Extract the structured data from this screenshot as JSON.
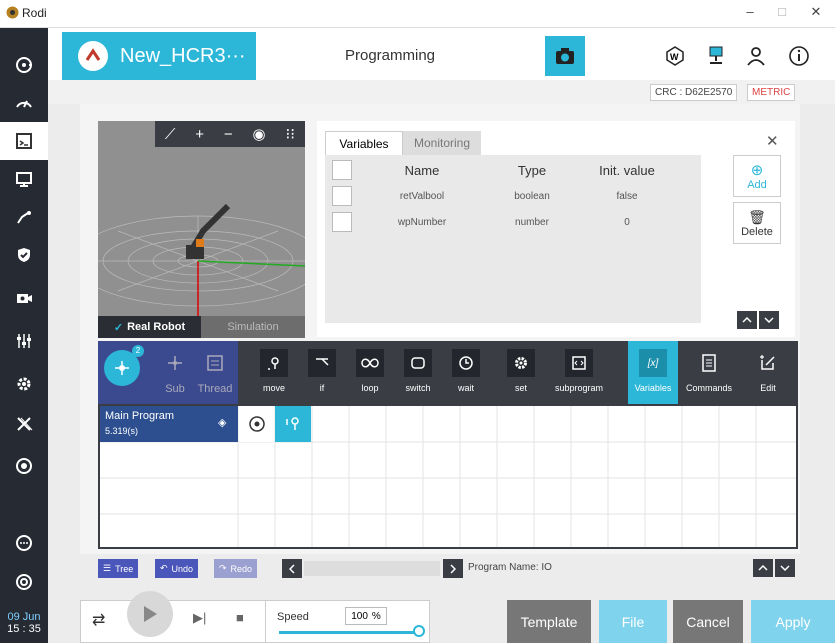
{
  "window": {
    "title": "Rodi"
  },
  "header": {
    "project_name": "New_HCR3···",
    "page_title": "Programming"
  },
  "status": {
    "crc": "CRC : D62E2570",
    "unit": "METRIC"
  },
  "viewport": {
    "tabs": [
      "Real Robot",
      "Simulation"
    ],
    "active_tab": "Real Robot"
  },
  "variables_panel": {
    "tabs": [
      "Variables",
      "Monitoring"
    ],
    "columns": [
      "Name",
      "Type",
      "Init. value"
    ],
    "rows": [
      {
        "name": "retValbool",
        "type": "boolean",
        "init": "false"
      },
      {
        "name": "wpNumber",
        "type": "number",
        "init": "0"
      }
    ],
    "add_label": "Add",
    "delete_label": "Delete"
  },
  "command_bar": {
    "left": [
      {
        "label": "Sub"
      },
      {
        "label": "Thread"
      }
    ],
    "badge": "2",
    "commands": [
      "move",
      "if",
      "loop",
      "switch",
      "wait",
      "set",
      "subprogram"
    ],
    "right": [
      "Variables",
      "Commands",
      "Edit"
    ]
  },
  "program": {
    "main_label": "Main Program",
    "time": "5.319(s)",
    "name_label": "Program Name: IO"
  },
  "nav": {
    "tree": "Tree",
    "undo": "Undo",
    "redo": "Redo"
  },
  "clock": {
    "date": "09 Jun",
    "time": "15 : 35"
  },
  "speed": {
    "label": "Speed",
    "value": "100",
    "unit": "%",
    "fraction": 1.0
  },
  "footer": {
    "template": "Template",
    "file": "File",
    "cancel": "Cancel",
    "apply": "Apply"
  },
  "colors": {
    "accent": "#2cb7d8",
    "sidebar": "#252a33",
    "cmdbar": "#3a3d44",
    "program": "#2d4f8f"
  }
}
